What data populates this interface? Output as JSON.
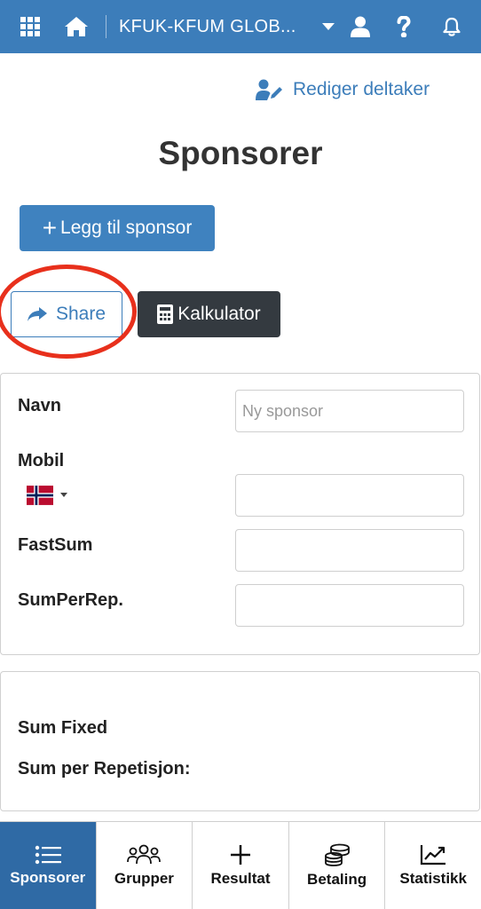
{
  "topbar": {
    "org_name": "KFUK-KFUM GLOB...",
    "icons": [
      "grid-icon",
      "home-icon",
      "chevron-down-icon",
      "user-icon",
      "help-icon",
      "bell-icon"
    ]
  },
  "header": {
    "edit_link": "Rediger deltaker",
    "page_title": "Sponsorer"
  },
  "actions": {
    "add_sponsor": "Legg til sponsor",
    "share": "Share",
    "calculator": "Kalkulator"
  },
  "form": {
    "name_label": "Navn",
    "name_placeholder": "Ny sponsor",
    "name_value": "",
    "mobile_label": "Mobil",
    "mobile_value": "",
    "fixed_sum_label": "FastSum",
    "fixed_sum_value": "",
    "sum_per_rep_label": "SumPerRep.",
    "sum_per_rep_value": ""
  },
  "summary": {
    "sum_fixed_label": "Sum Fixed",
    "sum_per_rep_label": "Sum per Repetisjon:"
  },
  "bottom_nav": [
    {
      "label": "Sponsorer",
      "icon": "list-icon",
      "active": true
    },
    {
      "label": "Grupper",
      "icon": "users-icon",
      "active": false
    },
    {
      "label": "Resultat",
      "icon": "plus-icon",
      "active": false
    },
    {
      "label": "Betaling",
      "icon": "coins-icon",
      "active": false
    },
    {
      "label": "Statistikk",
      "icon": "chart-line-icon",
      "active": false
    }
  ],
  "colors": {
    "primary": "#3c7dba",
    "nav_active": "#2f6aa5",
    "dark_button": "#343a40",
    "highlight": "#e8301c"
  }
}
